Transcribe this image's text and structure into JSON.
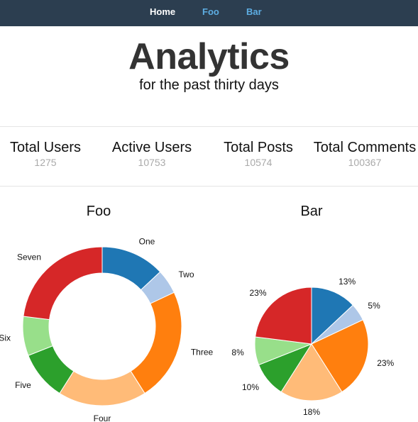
{
  "nav": {
    "items": [
      {
        "label": "Home",
        "active": true
      },
      {
        "label": "Foo",
        "active": false
      },
      {
        "label": "Bar",
        "active": false
      }
    ]
  },
  "header": {
    "title": "Analytics",
    "subtitle": "for the past thirty days"
  },
  "stats": [
    {
      "label": "Total Users",
      "value": "1275"
    },
    {
      "label": "Active Users",
      "value": "10753"
    },
    {
      "label": "Total Posts",
      "value": "10574"
    },
    {
      "label": "Total Comments",
      "value": "100367"
    }
  ],
  "colors": [
    "#1f77b4",
    "#aec7e8",
    "#ff7f0e",
    "#ffbb78",
    "#2ca02c",
    "#98df8a",
    "#d62728"
  ],
  "chart_data": [
    {
      "type": "pie",
      "style": "donut",
      "title": "Foo",
      "categories": [
        "One",
        "Two",
        "Three",
        "Four",
        "Five",
        "Six",
        "Seven"
      ],
      "values": [
        13,
        5,
        23,
        18,
        10,
        8,
        23
      ],
      "labels": [
        "One",
        "Two",
        "Three",
        "Four",
        "Five",
        "Six",
        "Seven"
      ]
    },
    {
      "type": "pie",
      "title": "Bar",
      "values": [
        13,
        5,
        23,
        18,
        10,
        8,
        23
      ],
      "labels": [
        "13%",
        "5%",
        "23%",
        "18%",
        "10%",
        "8%",
        "23%"
      ]
    }
  ]
}
